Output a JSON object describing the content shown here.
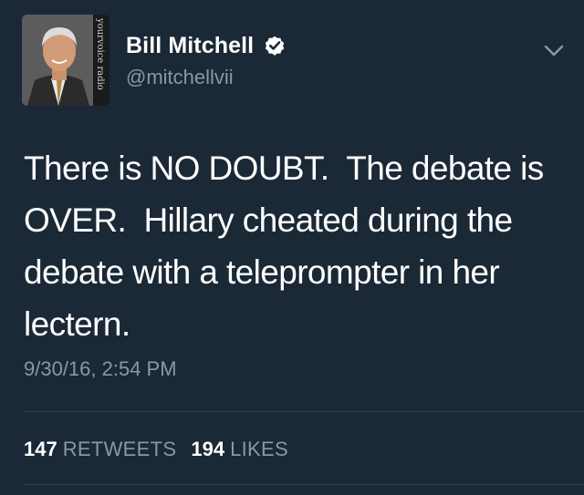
{
  "tweet": {
    "author": {
      "display_name": "Bill Mitchell",
      "handle": "@mitchellvii",
      "verified": true,
      "avatar_caption": "yourvoice radio"
    },
    "text": "There is NO DOUBT.  The debate is\nOVER.  Hillary cheated during the\ndebate with a teleprompter in her\nlectern.",
    "timestamp": "9/30/16, 2:54 PM",
    "stats": {
      "retweets_count": "147",
      "retweets_label": "RETWEETS",
      "likes_count": "194",
      "likes_label": "LIKES"
    }
  },
  "icons": {
    "verified": "verified-badge-icon",
    "menu": "chevron-down-icon"
  },
  "colors": {
    "background": "#1b2836",
    "primary_text": "#ffffff",
    "secondary_text": "#8899a6",
    "divider": "#38444d"
  }
}
